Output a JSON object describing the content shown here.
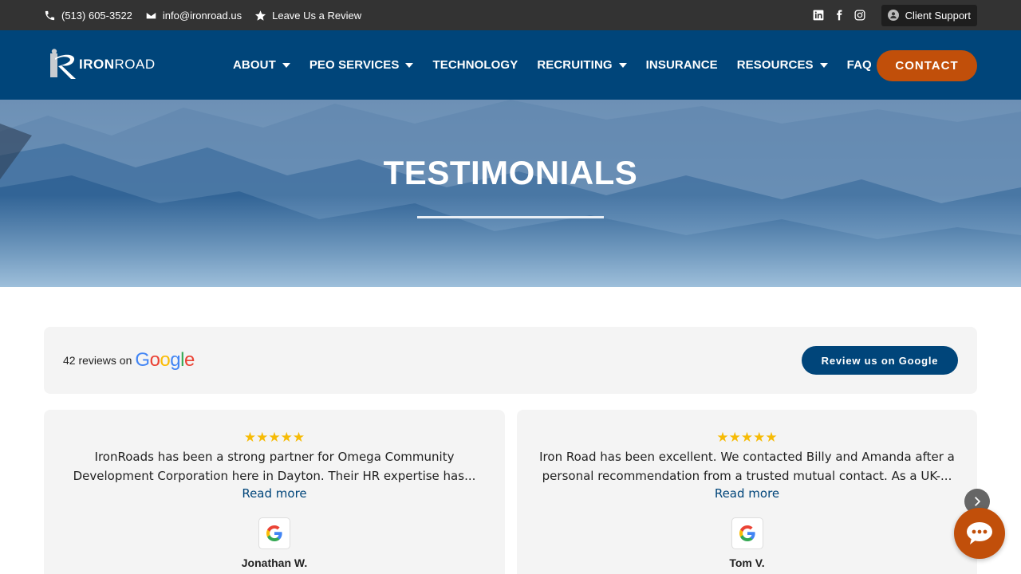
{
  "topbar": {
    "phone": "(513) 605-3522",
    "email": "info@ironroad.us",
    "review": "Leave Us a Review",
    "support": "Client Support",
    "social": [
      "linkedin-icon",
      "facebook-icon",
      "instagram-icon"
    ]
  },
  "nav": {
    "logo_text_bold": "IRON",
    "logo_text": "ROAD",
    "items": [
      {
        "label": "ABOUT",
        "dropdown": true
      },
      {
        "label": "PEO SERVICES",
        "dropdown": true
      },
      {
        "label": "TECHNOLOGY",
        "dropdown": false
      },
      {
        "label": "RECRUITING",
        "dropdown": true
      },
      {
        "label": "INSURANCE",
        "dropdown": false
      },
      {
        "label": "RESOURCES",
        "dropdown": true
      },
      {
        "label": "FAQ",
        "dropdown": false
      }
    ],
    "contact": "CONTACT"
  },
  "hero": {
    "title": "TESTIMONIALS"
  },
  "reviews": {
    "count_text": "42 reviews on",
    "google": "Google",
    "review_button": "Review us on Google",
    "cards": [
      {
        "stars": "★★★★★",
        "text": "IronRoads has been a strong partner for Omega Community Development Corporation here in Dayton. Their HR expertise has...",
        "more": "Read more",
        "name": "Jonathan W."
      },
      {
        "stars": "★★★★★",
        "text": "Iron Road has been excellent. We contacted Billy and Amanda after a personal recommendation from a trusted mutual contact. As a UK-...",
        "more": "Read more",
        "name": "Tom V."
      }
    ]
  },
  "colors": {
    "topbar": "#333333",
    "nav": "#00457a",
    "accent": "#c14f0a",
    "star": "#f6bb06"
  }
}
